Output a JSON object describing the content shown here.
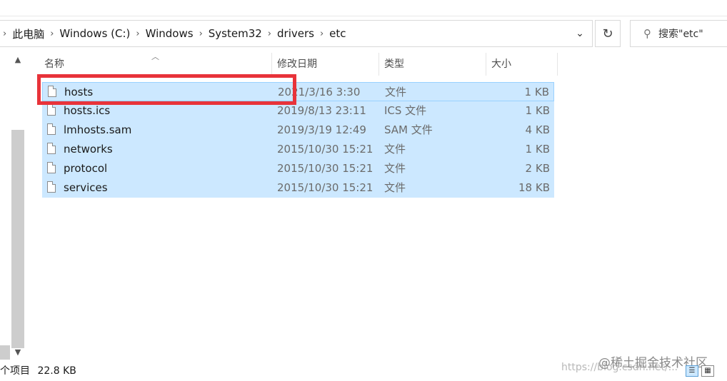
{
  "breadcrumb": [
    "此电脑",
    "Windows (C:)",
    "Windows",
    "System32",
    "drivers",
    "etc"
  ],
  "search": {
    "placeholder": "搜索\"etc\""
  },
  "columns": {
    "name": "名称",
    "date": "修改日期",
    "type": "类型",
    "size": "大小"
  },
  "files": [
    {
      "name": "hosts",
      "date": "2021/3/16 3:30",
      "type": "文件",
      "size": "1 KB"
    },
    {
      "name": "hosts.ics",
      "date": "2019/8/13 23:11",
      "type": "ICS 文件",
      "size": "1 KB"
    },
    {
      "name": "lmhosts.sam",
      "date": "2019/3/19 12:49",
      "type": "SAM 文件",
      "size": "4 KB"
    },
    {
      "name": "networks",
      "date": "2015/10/30 15:21",
      "type": "文件",
      "size": "1 KB"
    },
    {
      "name": "protocol",
      "date": "2015/10/30 15:21",
      "type": "文件",
      "size": "2 KB"
    },
    {
      "name": "services",
      "date": "2015/10/30 15:21",
      "type": "文件",
      "size": "18 KB"
    }
  ],
  "status": {
    "count": "个项目",
    "size": "22.8 KB"
  },
  "watermark": {
    "line1": "@稀土掘金技术社区",
    "line2": "https://blog.csdn.net/..."
  },
  "colors": {
    "selection": "#cce8ff",
    "highlight_border": "#e8333a"
  }
}
